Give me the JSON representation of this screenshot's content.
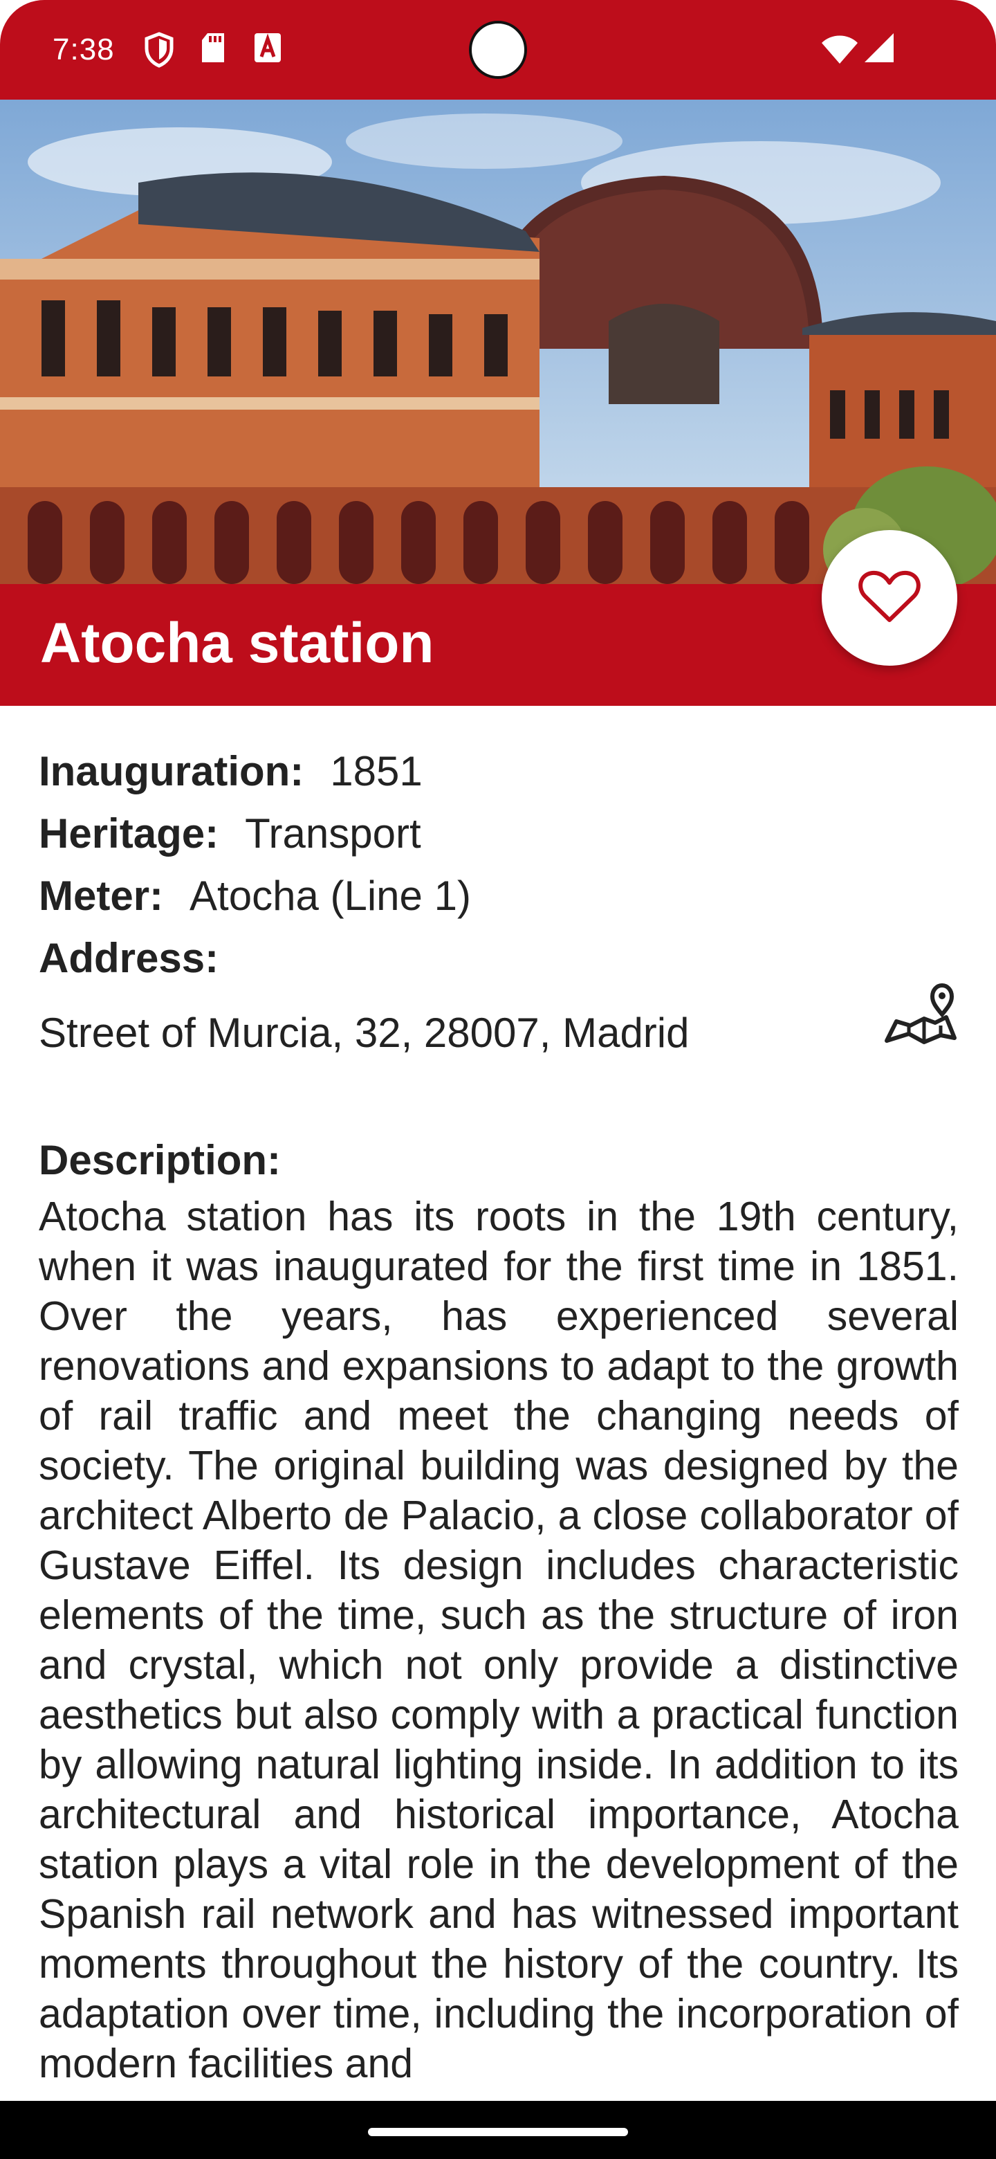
{
  "status_bar": {
    "time": "7:38",
    "icons": [
      "shield-icon",
      "sd-card-icon",
      "a-badge-icon",
      "wifi-icon",
      "cellular-signal-icon"
    ],
    "background": "#bd0d1b"
  },
  "hero": {
    "image": "Atocha station building photo"
  },
  "station": {
    "title": "Atocha station",
    "favorite_icon": "heart-outline-icon"
  },
  "details": {
    "inauguration_label": "Inauguration:",
    "inauguration_value": "1851",
    "heritage_label": "Heritage:",
    "heritage_value": "Transport",
    "meter_label": "Meter:",
    "meter_value": "Atocha (Line 1)",
    "address_label": "Address:",
    "address_value": "Street of Murcia, 32, 28007, Madrid",
    "map_icon": "map-pin-icon",
    "description_label": "Description:",
    "description_text": "Atocha station has its roots in the 19th century, when it was inaugurated for the first time in 1851. Over the years, has experienced several renovations and expansions to adapt to the growth of rail traffic and meet the changing needs of society. The original building was designed by the architect Alberto de Palacio, a close collaborator of Gustave Eiffel. Its design includes characteristic elements of the time, such as the structure of iron and crystal, which not only provide a distinctive aesthetics but also comply with a practical function by allowing natural lighting inside. In addition to its architectural and historical importance, Atocha station plays a vital role in the development of the Spanish rail network and has witnessed important moments throughout the history of the country. Its adaptation over time, including the incorporation of modern facilities and"
  },
  "colors": {
    "accent": "#bd0d1b",
    "text": "#222222"
  }
}
